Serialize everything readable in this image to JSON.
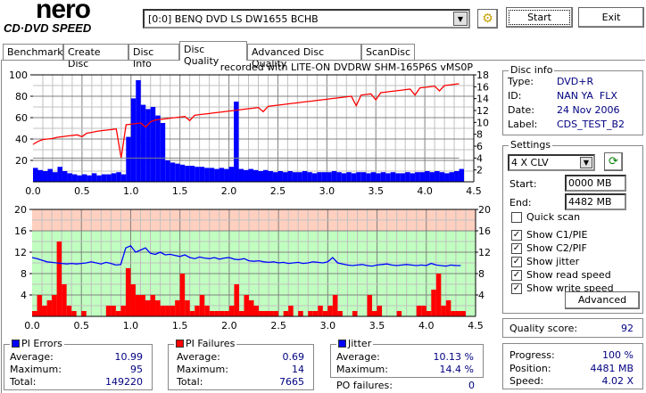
{
  "app": {
    "logo_top": "nero",
    "logo_bottom": "CD·DVD SPEED"
  },
  "toolbar": {
    "drive": "[0:0]  BENQ DVD LS DW1655 BCHB",
    "start_label": "Start",
    "exit_label": "Exit",
    "drive_icon": "drive-config-icon"
  },
  "tabs": [
    {
      "label": "Benchmark"
    },
    {
      "label": "Create Disc"
    },
    {
      "label": "Disc Info"
    },
    {
      "label": "Disc Quality",
      "selected": true
    },
    {
      "label": "Advanced Disc Quality"
    },
    {
      "label": "ScanDisc"
    }
  ],
  "chart_title": "recorded with LITE-ON DVDRW SHM-165P6S vMS0P",
  "disc_info": {
    "title": "Disc info",
    "type_label": "Type:",
    "type": "DVD+R",
    "id_label": "ID:",
    "id": "NAN YA  FLX",
    "date_label": "Date:",
    "date": "24 Nov 2006",
    "label_label": "Label:",
    "label": "CDS_TEST_B2"
  },
  "settings": {
    "title": "Settings",
    "speed": "4 X CLV",
    "start_label": "Start:",
    "start": "0000 MB",
    "end_label": "End:",
    "end": "4482 MB",
    "checks": [
      {
        "label": "Quick scan",
        "checked": false
      },
      {
        "label": "Show C1/PIE",
        "checked": true
      },
      {
        "label": "Show C2/PIF",
        "checked": true
      },
      {
        "label": "Show jitter",
        "checked": true
      },
      {
        "label": "Show read speed",
        "checked": true
      },
      {
        "label": "Show write speed",
        "checked": true
      }
    ],
    "advanced_label": "Advanced"
  },
  "quality": {
    "label": "Quality score:",
    "value": "92"
  },
  "progress": {
    "progress_label": "Progress:",
    "progress": "100 %",
    "position_label": "Position:",
    "position": "4481 MB",
    "speed_label": "Speed:",
    "speed": "4.02 X"
  },
  "pi_errors": {
    "title": "PI Errors",
    "color": "#0000ff",
    "avg_label": "Average:",
    "avg": "10.99",
    "max_label": "Maximum:",
    "max": "95",
    "total_label": "Total:",
    "total": "149220"
  },
  "pi_failures": {
    "title": "PI Failures",
    "color": "#ff0000",
    "avg_label": "Average:",
    "avg": "0.69",
    "max_label": "Maximum:",
    "max": "14",
    "total_label": "Total:",
    "total": "7665"
  },
  "jitter": {
    "title": "Jitter",
    "color": "#0000ff",
    "avg_label": "Average:",
    "avg": "10.13 %",
    "max_label": "Maximum:",
    "max": "14.4 %"
  },
  "po_failures": {
    "label": "PO failures:",
    "value": "0"
  },
  "chart_data": [
    {
      "type": "bar+line",
      "x_step": 0.05,
      "xlim": [
        0,
        4.5
      ],
      "x_ticks": [
        "0.0",
        "0.5",
        "1.0",
        "1.5",
        "2.0",
        "2.5",
        "3.0",
        "3.5",
        "4.0",
        "4.5"
      ],
      "ylim_left": [
        0,
        100
      ],
      "y_ticks_left": [
        "100",
        "80",
        "60",
        "40",
        "20"
      ],
      "ylim_right": [
        0,
        18
      ],
      "y_ticks_right": [
        "18",
        "16",
        "14",
        "12",
        "10",
        "8",
        "6",
        "4",
        "2"
      ],
      "grid": true,
      "series": [
        {
          "kind": "bar",
          "axis": "left",
          "color": "#0000ff",
          "values": [
            13,
            11,
            10,
            12,
            9,
            14,
            10,
            8,
            7,
            6,
            7,
            6,
            8,
            6,
            7,
            7,
            8,
            9,
            7,
            42,
            78,
            95,
            72,
            68,
            70,
            62,
            55,
            20,
            18,
            17,
            16,
            15,
            15,
            14,
            14,
            13,
            13,
            12,
            13,
            12,
            14,
            75,
            12,
            11,
            12,
            11,
            10,
            11,
            10,
            9,
            10,
            9,
            10,
            9,
            9,
            10,
            9,
            8,
            9,
            9,
            9,
            10,
            9,
            8,
            9,
            8,
            9,
            9,
            8,
            9,
            8,
            9,
            8,
            9,
            8,
            8,
            9,
            8,
            9,
            9,
            10,
            9,
            10,
            9,
            8,
            9,
            10,
            12
          ]
        },
        {
          "kind": "line",
          "axis": "right",
          "color": "#ff0000",
          "values": [
            6.3,
            6.8,
            7.1,
            7.2,
            7.3,
            7.5,
            7.6,
            7.7,
            7.8,
            7.9,
            7.6,
            8.2,
            8.3,
            8.5,
            8.6,
            8.7,
            8.8,
            8.9,
            4.0,
            9.6,
            9.7,
            9.8,
            9.9,
            9.2,
            10.1,
            10.4,
            10.5,
            10.6,
            10.7,
            10.8,
            10.9,
            11.0,
            10.3,
            11.2,
            11.3,
            11.4,
            11.5,
            11.6,
            11.7,
            11.8,
            11.9,
            12.0,
            12.1,
            12.2,
            12.3,
            12.4,
            12.5,
            11.8,
            12.7,
            12.8,
            12.9,
            13.0,
            13.1,
            13.2,
            13.3,
            13.4,
            13.5,
            13.6,
            13.7,
            13.8,
            13.9,
            14.0,
            14.1,
            14.2,
            14.3,
            14.4,
            12.8,
            14.6,
            14.7,
            14.8,
            13.8,
            15.0,
            15.1,
            15.2,
            15.3,
            15.4,
            15.5,
            15.6,
            14.6,
            15.8,
            15.9,
            16.0,
            16.1,
            15.3,
            16.2,
            16.3,
            16.4,
            16.5
          ]
        },
        {
          "kind": "line",
          "axis": "right",
          "color": "#808080",
          "constant": 4.0,
          "xrange": [
            0,
            4.35
          ]
        }
      ]
    },
    {
      "type": "bar+line",
      "x_step": 0.05,
      "xlim": [
        0,
        4.5
      ],
      "x_ticks": [
        "0.0",
        "0.5",
        "1.0",
        "1.5",
        "2.0",
        "2.5",
        "3.0",
        "3.5",
        "4.0",
        "4.5"
      ],
      "ylim": [
        0,
        20
      ],
      "y_ticks": [
        "20",
        "16",
        "12",
        "8",
        "4"
      ],
      "bands": [
        {
          "from": 16,
          "to": 20,
          "color": "#ffd0c0"
        },
        {
          "from": 0,
          "to": 16,
          "color": "#c0ffc0"
        }
      ],
      "grid": true,
      "series": [
        {
          "kind": "bar",
          "color": "#ff0000",
          "values": [
            1,
            4,
            2,
            3,
            4,
            14,
            6,
            2,
            1,
            0,
            1,
            0,
            0,
            0,
            0,
            2,
            2,
            1,
            2,
            9,
            6,
            4,
            4,
            3,
            4,
            3,
            2,
            2,
            2,
            3,
            8,
            3,
            1,
            2,
            4,
            2,
            1,
            1,
            1,
            1,
            2,
            6,
            1,
            4,
            3,
            2,
            1,
            1,
            1,
            1,
            0,
            1,
            2,
            0,
            1,
            0,
            1,
            1,
            2,
            1,
            2,
            4,
            1,
            0,
            0,
            1,
            0,
            0,
            4,
            1,
            2,
            0,
            0,
            0,
            1,
            0,
            0,
            0,
            2,
            2,
            1,
            5,
            8,
            2,
            3,
            1,
            1,
            1
          ]
        },
        {
          "kind": "line",
          "color": "#0000ff",
          "values": [
            11.0,
            10.8,
            10.5,
            10.2,
            10.1,
            10.0,
            9.9,
            9.8,
            9.9,
            9.8,
            9.9,
            10.0,
            10.2,
            10.0,
            9.8,
            10.1,
            9.9,
            9.6,
            9.7,
            12.8,
            13.2,
            12.0,
            12.4,
            12.8,
            11.8,
            11.6,
            12.0,
            11.5,
            11.6,
            11.4,
            11.2,
            11.5,
            11.0,
            10.8,
            11.1,
            10.9,
            10.8,
            11.0,
            10.7,
            10.9,
            11.0,
            10.7,
            10.6,
            10.8,
            10.4,
            10.3,
            10.4,
            10.2,
            10.1,
            10.2,
            10.0,
            10.1,
            9.9,
            10.0,
            10.1,
            9.9,
            10.0,
            10.2,
            10.1,
            10.0,
            10.2,
            11.0,
            10.0,
            9.8,
            9.6,
            9.5,
            9.6,
            9.7,
            9.5,
            9.4,
            9.6,
            9.7,
            9.8,
            9.6,
            9.5,
            9.6,
            9.7,
            9.6,
            9.5,
            9.6,
            9.5,
            9.9,
            9.6,
            9.5,
            9.4,
            9.6,
            9.5,
            9.5
          ]
        }
      ]
    }
  ]
}
